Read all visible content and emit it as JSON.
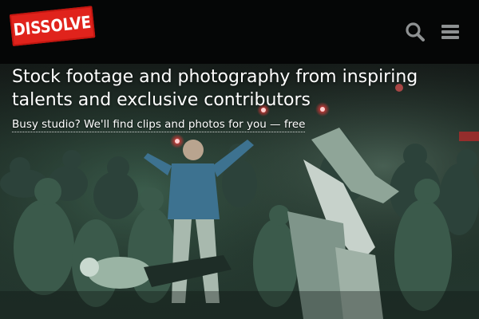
{
  "header": {
    "logo_text": "DISSOLVE",
    "logo_color": "#e0231c",
    "search_icon": "search-icon",
    "menu_icon": "hamburger-menu-icon"
  },
  "hero": {
    "headline": "Stock footage and photography from inspiring talents and exclusive contributors",
    "subline": "Busy studio? We'll find clips and photos for you — free"
  }
}
